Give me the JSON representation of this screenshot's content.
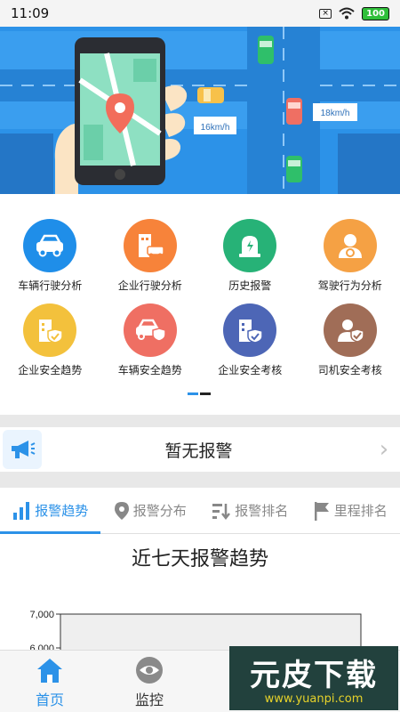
{
  "status_bar": {
    "time": "11:09",
    "battery": "100"
  },
  "banner": {
    "speed_labels": [
      "16km/h",
      "18km/h"
    ],
    "slide_count": 2,
    "active_slide": 1
  },
  "grid": {
    "items": [
      {
        "label": "车辆行驶分析",
        "color": "#1f8ee9",
        "icon": "car-icon"
      },
      {
        "label": "企业行驶分析",
        "color": "#f7833a",
        "icon": "building-car-icon"
      },
      {
        "label": "历史报警",
        "color": "#27b277",
        "icon": "alarm-icon"
      },
      {
        "label": "驾驶行为分析",
        "color": "#f5a144",
        "icon": "driver-icon"
      },
      {
        "label": "企业安全趋势",
        "color": "#f3c13c",
        "icon": "building-shield-icon"
      },
      {
        "label": "车辆安全趋势",
        "color": "#ef6f63",
        "icon": "car-shield-icon"
      },
      {
        "label": "企业安全考核",
        "color": "#4d66b6",
        "icon": "building-check-icon"
      },
      {
        "label": "司机安全考核",
        "color": "#a06d57",
        "icon": "person-check-icon"
      }
    ]
  },
  "alarm_notice": {
    "text": "暂无报警"
  },
  "tabs": [
    {
      "label": "报警趋势",
      "icon": "bar-chart-icon",
      "active": true
    },
    {
      "label": "报警分布",
      "icon": "location-pin-icon",
      "active": false
    },
    {
      "label": "报警排名",
      "icon": "sort-icon",
      "active": false
    },
    {
      "label": "里程排名",
      "icon": "flag-icon",
      "active": false
    }
  ],
  "chart_data": {
    "type": "bar",
    "title": "近七天报警趋势",
    "yticks": [
      "7,000",
      "6,000"
    ],
    "categories": [],
    "values": []
  },
  "bottom_nav": [
    {
      "label": "首页",
      "icon": "home-icon",
      "active": true
    },
    {
      "label": "监控",
      "icon": "eye-icon",
      "active": false
    }
  ],
  "watermark": {
    "main": "元皮下载",
    "sub": "www.yuanpi.com"
  }
}
